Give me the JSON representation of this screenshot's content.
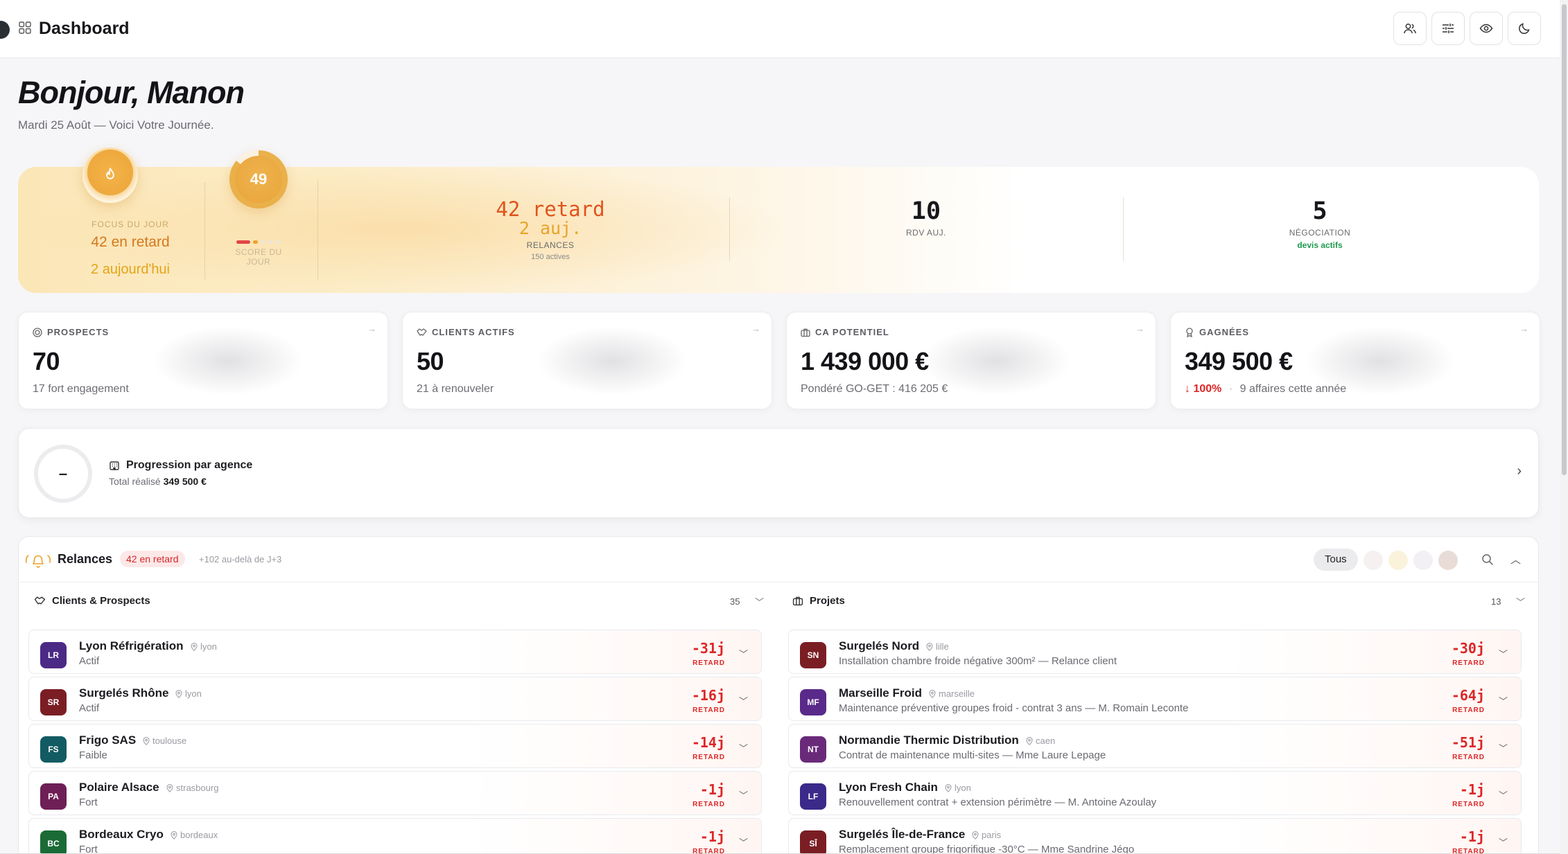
{
  "header": {
    "title": "Dashboard",
    "tools": [
      {
        "name": "users-icon"
      },
      {
        "name": "sliders-icon"
      },
      {
        "name": "eye-icon"
      },
      {
        "name": "moon-icon"
      }
    ]
  },
  "greeting": {
    "title": "Bonjour, Manon",
    "subtitle": "Mardi 25 Août — Voici Votre Journée."
  },
  "focus": {
    "label": "FOCUS DU JOUR",
    "late": "42 en retard",
    "today": "2 aujourd'hui",
    "score": "49",
    "score_label": "SCORE DU JOUR",
    "relances_late": "42 retard",
    "relances_today": "2 auj.",
    "relances_label": "RELANCES",
    "relances_active": "150 actives",
    "rdv_value": "10",
    "rdv_label": "RDV AUJ.",
    "nego_value": "5",
    "nego_label": "NÉGOCIATION",
    "nego_sub": "devis actifs"
  },
  "kpis": [
    {
      "label": "PROSPECTS",
      "icon": "target-icon",
      "value": "70",
      "sub": "17 fort engagement"
    },
    {
      "label": "CLIENTS ACTIFS",
      "icon": "handshake-icon",
      "value": "50",
      "sub": "21 à renouveler"
    },
    {
      "label": "CA POTENTIEL",
      "icon": "briefcase-icon",
      "value": "1 439 000 €",
      "sub": "Pondéré GO-GET : 416 205 €"
    },
    {
      "label": "GAGNÉES",
      "icon": "award-icon",
      "value": "349 500 €",
      "sub_delta": "↓ 100%",
      "sub_sep": "·",
      "sub": "9 affaires cette année"
    }
  ],
  "progression": {
    "ring_value": "–",
    "title": "Progression par agence",
    "total_label": "Total réalisé",
    "total_value": "349 500 €"
  },
  "relances": {
    "title": "Relances",
    "late_pill": "42 en retard",
    "beyond": "+102 au-delà de J+3",
    "filter": "Tous",
    "colors": {
      "accent_red": "#dc2626",
      "filter_dots": [
        "#f6f0f0",
        "#fbf2dc",
        "#f2f0f4",
        "#e9dcd6"
      ]
    },
    "clients": {
      "title": "Clients & Prospects",
      "count": "35",
      "rows": [
        {
          "initials": "LR",
          "name": "Lyon Réfrigération",
          "loc": "lyon",
          "sub": "Actif",
          "days": "-31j",
          "color": "#4b2a86"
        },
        {
          "initials": "SR",
          "name": "Surgelés Rhône",
          "loc": "lyon",
          "sub": "Actif",
          "days": "-16j",
          "color": "#7a1e24"
        },
        {
          "initials": "FS",
          "name": "Frigo SAS",
          "loc": "toulouse",
          "sub": "Faible",
          "days": "-14j",
          "color": "#135b63"
        },
        {
          "initials": "PA",
          "name": "Polaire Alsace",
          "loc": "strasbourg",
          "sub": "Fort",
          "days": "-1j",
          "color": "#6e1f55"
        },
        {
          "initials": "BC",
          "name": "Bordeaux Cryo",
          "loc": "bordeaux",
          "sub": "Fort",
          "days": "-1j",
          "color": "#1b6b36"
        }
      ]
    },
    "projects": {
      "title": "Projets",
      "count": "13",
      "rows": [
        {
          "initials": "SN",
          "name": "Surgelés Nord",
          "loc": "lille",
          "sub": "Installation chambre froide négative 300m² — Relance client",
          "days": "-30j",
          "color": "#7a1e24"
        },
        {
          "initials": "MF",
          "name": "Marseille Froid",
          "loc": "marseille",
          "sub": "Maintenance préventive groupes froid - contrat 3 ans — M. Romain Leconte",
          "days": "-64j",
          "color": "#5a2a8a"
        },
        {
          "initials": "NT",
          "name": "Normandie Thermic Distribution",
          "loc": "caen",
          "sub": "Contrat de maintenance multi-sites — Mme Laure Lepage",
          "days": "-51j",
          "color": "#6a2a7a"
        },
        {
          "initials": "LF",
          "name": "Lyon Fresh Chain",
          "loc": "lyon",
          "sub": "Renouvellement contrat + extension périmètre — M. Antoine Azoulay",
          "days": "-1j",
          "color": "#3b2a8a"
        },
        {
          "initials": "SÎ",
          "name": "Surgelés Île-de-France",
          "loc": "paris",
          "sub": "Remplacement groupe frigorifique -30°C — Mme Sandrine Jégo",
          "days": "-1j",
          "color": "#7a1e24"
        }
      ]
    },
    "retard_label": "RETARD"
  }
}
